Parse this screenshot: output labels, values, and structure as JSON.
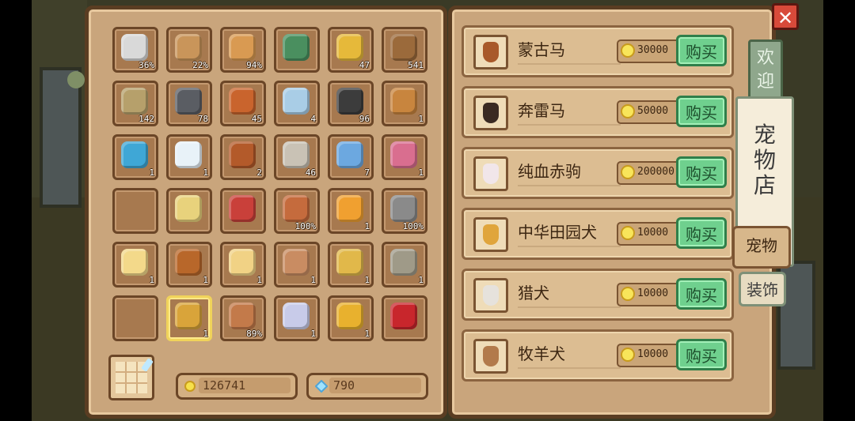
{
  "inventory": {
    "slots": [
      {
        "icon": "sickle-icon",
        "count": "36%",
        "color": "#d9d9d9"
      },
      {
        "icon": "bow-icon",
        "count": "22%",
        "color": "#c9955a"
      },
      {
        "icon": "bow-icon",
        "count": "94%",
        "color": "#d99a52"
      },
      {
        "icon": "shovel-icon",
        "count": "",
        "color": "#4a8f5f"
      },
      {
        "icon": "wheat-icon",
        "count": "47",
        "color": "#e6b93a"
      },
      {
        "icon": "wood-log-icon",
        "count": "541",
        "color": "#9b6a3b"
      },
      {
        "icon": "stone-icon",
        "count": "142",
        "color": "#b6a06b"
      },
      {
        "icon": "iron-ore-icon",
        "count": "78",
        "color": "#5a5d63"
      },
      {
        "icon": "copper-ore-icon",
        "count": "45",
        "color": "#c9642d"
      },
      {
        "icon": "silver-bar-icon",
        "count": "4",
        "color": "#a9cde6"
      },
      {
        "icon": "coal-icon",
        "count": "96",
        "color": "#3c3c3c"
      },
      {
        "icon": "flute-icon",
        "count": "1",
        "color": "#c8853e"
      },
      {
        "icon": "fish-icon",
        "count": "1",
        "color": "#3fa7d6"
      },
      {
        "icon": "milk-jug-icon",
        "count": "1",
        "color": "#e8f2f8"
      },
      {
        "icon": "firecracker-icon",
        "count": "2",
        "color": "#b35a2a"
      },
      {
        "icon": "rock-icon",
        "count": "46",
        "color": "#c9c2b5"
      },
      {
        "icon": "glue-tube-icon",
        "count": "7",
        "color": "#6ca8e0"
      },
      {
        "icon": "kite-icon",
        "count": "1",
        "color": "#d96e8f"
      },
      {
        "icon": "",
        "count": "",
        "color": ""
      },
      {
        "icon": "banana-sword-icon",
        "count": "",
        "color": "#e8d27c"
      },
      {
        "icon": "red-sword-icon",
        "count": "",
        "color": "#c9403a"
      },
      {
        "icon": "axe-icon",
        "count": "100%",
        "color": "#c56b3d"
      },
      {
        "icon": "amber-gem-icon",
        "count": "1",
        "color": "#f0a030"
      },
      {
        "icon": "pickaxe-icon",
        "count": "100%",
        "color": "#8a8a8a"
      },
      {
        "icon": "popcorn-icon",
        "count": "1",
        "color": "#f3d98a"
      },
      {
        "icon": "acorn-icon",
        "count": "1",
        "color": "#b8672a"
      },
      {
        "icon": "bread-icon",
        "count": "1",
        "color": "#f1d285"
      },
      {
        "icon": "basket-icon",
        "count": "1",
        "color": "#c98c62"
      },
      {
        "icon": "corn-icon",
        "count": "1",
        "color": "#e1b84a"
      },
      {
        "icon": "net-icon",
        "count": "1",
        "color": "#9f9a88"
      },
      {
        "icon": "",
        "count": "",
        "color": ""
      },
      {
        "icon": "scepter-icon",
        "count": "1",
        "color": "#d9a43a"
      },
      {
        "icon": "scythe-icon",
        "count": "89%",
        "color": "#c37a4a"
      },
      {
        "icon": "ribbon-icon",
        "count": "1",
        "color": "#c8cbe9"
      },
      {
        "icon": "goldfish-icon",
        "count": "1",
        "color": "#e8b12e"
      },
      {
        "icon": "treasure-chest-icon",
        "count": "",
        "color": "#c8262c"
      }
    ],
    "selected_index": 31
  },
  "currency": {
    "gold": "126741",
    "gems": "790"
  },
  "shop": {
    "items": [
      {
        "name": "蒙古马",
        "price": "30000",
        "buy": "购买",
        "face": "#a8592a"
      },
      {
        "name": "奔雷马",
        "price": "50000",
        "buy": "购买",
        "face": "#3a2a22"
      },
      {
        "name": "纯血赤驹",
        "price": "200000",
        "buy": "购买",
        "face": "#f1e6ea"
      },
      {
        "name": "中华田园犬",
        "price": "10000",
        "buy": "购买",
        "face": "#e0a53c"
      },
      {
        "name": "猎犬",
        "price": "10000",
        "buy": "购买",
        "face": "#e6e2dc"
      },
      {
        "name": "牧羊犬",
        "price": "10000",
        "buy": "购买",
        "face": "#b27a4b"
      }
    ]
  },
  "tabs": {
    "welcome": "欢迎",
    "pet_shop": "宠物店",
    "pets": "宠物",
    "decoration": "装饰"
  },
  "close_label": "✕"
}
